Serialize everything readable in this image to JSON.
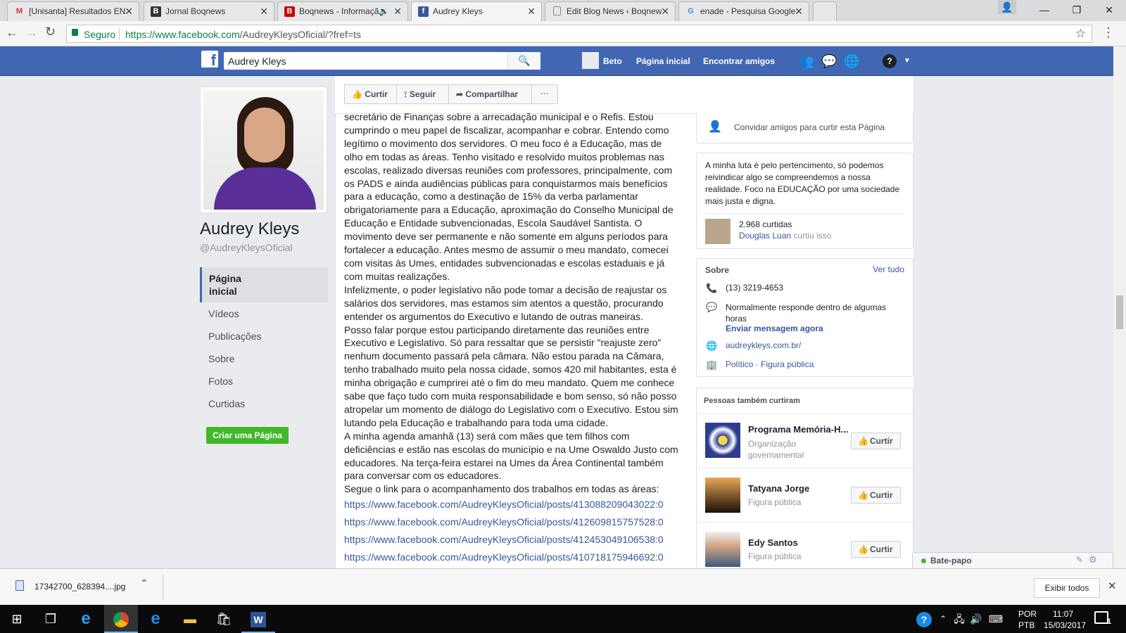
{
  "tabs": [
    {
      "title": "[Unisanta] Resultados EN",
      "icon": "gmail-icon",
      "fav": "M",
      "favcolor": "#d93025",
      "favbg": "transparent"
    },
    {
      "title": "Jornal Boqnews",
      "icon": "boqnews-icon",
      "fav": "B",
      "favcolor": "#fff",
      "favbg": "#333"
    },
    {
      "title": "Boqnews - Informaçã",
      "icon": "boqnews-icon",
      "fav": "B",
      "favcolor": "#fff",
      "favbg": "#c00"
    },
    {
      "title": "Audrey Kleys",
      "icon": "facebook-icon",
      "fav": "f",
      "favcolor": "#fff",
      "favbg": "#3b5998"
    },
    {
      "title": "Edit Blog News ‹ Boqnew",
      "icon": "page-icon",
      "fav": "▯",
      "favcolor": "#666",
      "favbg": "transparent"
    },
    {
      "title": "enade - Pesquisa Google",
      "icon": "google-icon",
      "fav": "G",
      "favcolor": "#4285f4",
      "favbg": "transparent"
    }
  ],
  "address": {
    "secure": "Seguro",
    "url_host": "https://www.facebook.com",
    "url_path": "/AudreyKleysOficial/?fref=ts"
  },
  "fb": {
    "search_value": "Audrey Kleys",
    "user": "Beto",
    "home": "Página inicial",
    "find_friends": "Encontrar amigos"
  },
  "profile": {
    "name": "Audrey Kleys",
    "handle": "@AudreyKleysOficial"
  },
  "leftnav": {
    "active": "Página inicial",
    "items": [
      "Vídeos",
      "Publicações",
      "Sobre",
      "Fotos",
      "Curtidas"
    ],
    "create": "Criar uma Página"
  },
  "actions": {
    "like": "Curtir",
    "follow": "Seguir",
    "share": "Compartilhar",
    "more": "···"
  },
  "post": {
    "paragraphs": [
      "secretário de Finanças sobre a arrecadação municipal e o Refis. Estou cumprindo o meu papel de fiscalizar, acompanhar e cobrar. Entendo como legítimo o movimento dos servidores. O meu foco é a Educação, mas de olho em todas as áreas. Tenho visitado e resolvido muitos problemas nas escolas, realizado diversas reuniões com professores, principalmente, com os PADS e ainda audiências públicas para conquistarmos mais benefícios para a educação, como a destinação de 15% da verba parlamentar obrigatoriamente para a Educação, aproximação do Conselho Municipal de Educação e Entidade subvencionadas, Escola Saudável Santista. O movimento deve ser permanente e não somente em alguns períodos para fortalecer a educação. Antes mesmo de assumir o meu mandato, comecei com visitas às Umes, entidades subvencionadas e escolas estaduais e já com muitas realizações.",
      "Infelizmente, o poder legislativo não pode tomar a decisão de reajustar os salários dos servidores, mas estamos sim atentos a questão, procurando entender os argumentos do Executivo e lutando de outras maneiras.",
      "Posso falar porque estou participando diretamente das reuniões entre Executivo e Legislativo. Só para ressaltar que se persistir \"reajuste zero\" nenhum documento passará pela câmara. Não estou parada na Câmara, tenho trabalhado muito pela nossa cidade, somos 420 mil habitantes, esta é minha obrigação e cumprirei até o fim do meu mandato. Quem me conhece sabe que faço tudo com muita responsabilidade e bom senso, só não posso atropelar um momento de diálogo do Legislativo com o Executivo. Estou sim lutando pela Educação e trabalhando para toda uma cidade.",
      "A minha agenda amanhã (13) será com mães que tem filhos com deficiências e estão nas escolas do município e na Ume Oswaldo Justo com educadores. Na terça-feira estarei na Umes da Área Continental também para conversar com os educadores.",
      "Segue o link para o acompanhamento dos trabalhos em todas as áreas:"
    ],
    "links": [
      "https://www.facebook.com/AudreyKleysOficial/posts/413088209043022:0",
      "https://www.facebook.com/AudreyKleysOficial/posts/412609815757528:0",
      "https://www.facebook.com/AudreyKleysOficial/posts/412453049106538:0",
      "https://www.facebook.com/AudreyKleysOficial/posts/410718175946692:0"
    ]
  },
  "right": {
    "invite": "Convidar amigos para curtir esta Página",
    "about_text": "A minha luta é pelo pertencimento, só podemos reivindicar algo se compreendemos a nossa realidade. Foco na EDUCAÇÃO por uma sociedade mais justa e digna.",
    "likes_count": "2.968 curtidas",
    "liker_name": "Douglas Luan",
    "liker_action": "curtiu isso",
    "about_title": "Sobre",
    "see_all": "Ver tudo",
    "phone": "(13) 3219-4653",
    "response": "Normalmente responde dentro de algumas horas",
    "send_msg": "Enviar mensagem agora",
    "website": "audreykleys.com.br/",
    "category": "Político · Figura pública",
    "also_liked_title": "Pessoas também curtiram",
    "also_liked": [
      {
        "name": "Programa Memória-H...",
        "sub": "Organização governamental",
        "btn": "Curtir"
      },
      {
        "name": "Tatyana Jorge",
        "sub": "Figura pública",
        "btn": "Curtir"
      },
      {
        "name": "Edy Santos",
        "sub": "Figura pública",
        "btn": "Curtir"
      }
    ],
    "chat": "Bate-papo"
  },
  "download": {
    "file": "17342700_628394....jpg",
    "show_all": "Exibir todos"
  },
  "taskbar": {
    "lang1": "POR",
    "lang2": "PTB",
    "time": "11:07",
    "date": "15/03/2017",
    "notif": "1"
  }
}
